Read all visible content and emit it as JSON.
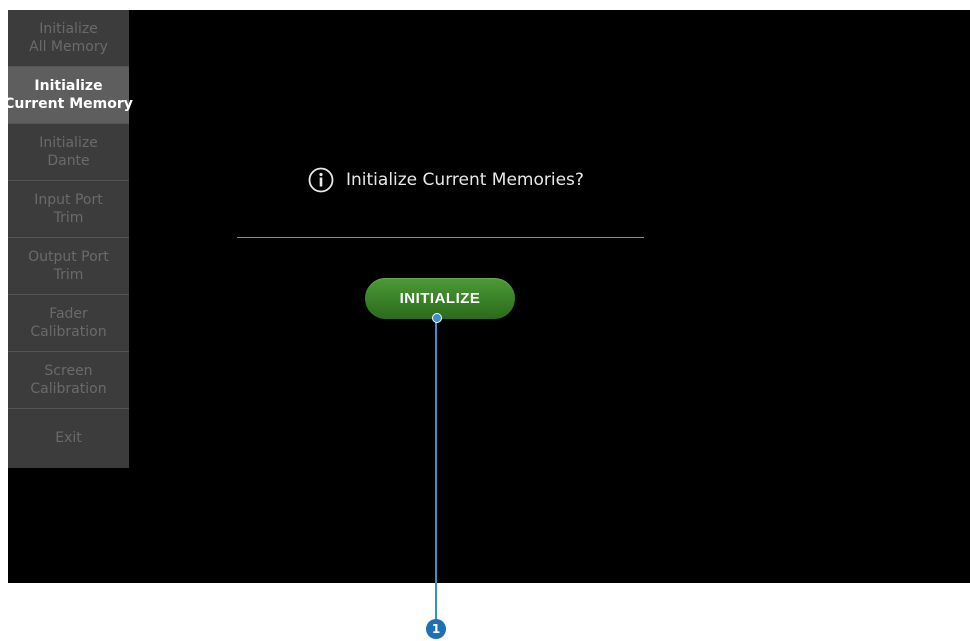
{
  "sidebar": {
    "items": [
      {
        "line1": "Initialize",
        "line2": "All Memory",
        "active": false
      },
      {
        "line1": "Initialize",
        "line2": "Current Memory",
        "active": true
      },
      {
        "line1": "Initialize",
        "line2": "Dante",
        "active": false
      },
      {
        "line1": "Input Port",
        "line2": "Trim",
        "active": false
      },
      {
        "line1": "Output Port",
        "line2": "Trim",
        "active": false
      },
      {
        "line1": "Fader",
        "line2": "Calibration",
        "active": false
      },
      {
        "line1": "Screen",
        "line2": "Calibration",
        "active": false
      }
    ],
    "exit_label": "Exit"
  },
  "dialog": {
    "icon": "info-icon",
    "message": "Initialize Current Memories?",
    "button_label": "INITIALIZE"
  },
  "callout": {
    "number": "1"
  },
  "colors": {
    "button_green": "#3f8a2c",
    "callout_blue": "#1f6fb5",
    "active_item": "#5e5e5e"
  }
}
